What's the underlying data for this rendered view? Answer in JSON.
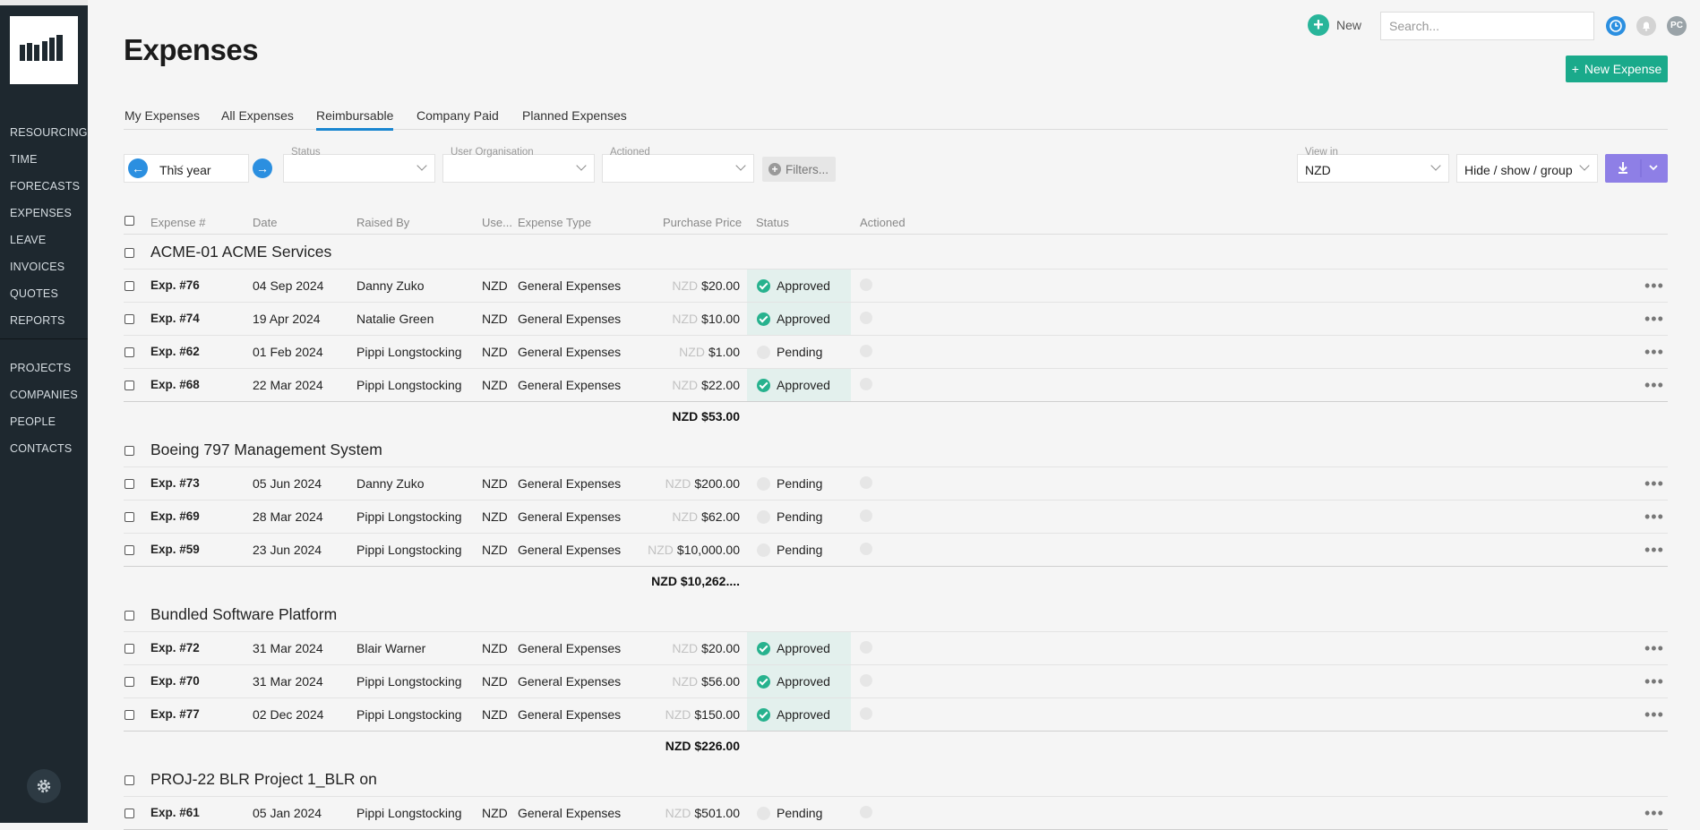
{
  "nav": {
    "items": [
      "RESOURCING",
      "TIME",
      "FORECASTS",
      "EXPENSES",
      "LEAVE",
      "INVOICES",
      "QUOTES",
      "REPORTS"
    ],
    "items2": [
      "PROJECTS",
      "COMPANIES",
      "PEOPLE",
      "CONTACTS"
    ]
  },
  "topbar": {
    "new_label": "New",
    "search_placeholder": "Search...",
    "avatar_initials": "PC"
  },
  "page": {
    "title": "Expenses",
    "new_expense_label": "New Expense"
  },
  "tabs": [
    "My Expenses",
    "All Expenses",
    "Reimbursable",
    "Company Paid",
    "Planned Expenses"
  ],
  "active_tab": "Reimbursable",
  "filters": {
    "period": "This year",
    "status_label": "Status",
    "status_value": "",
    "userorg_label": "User Organisation",
    "userorg_value": "",
    "actioned_label": "Actioned",
    "actioned_value": "",
    "filters_label": "Filters...",
    "viewin_label": "View in",
    "viewin_value": "NZD",
    "hideshow_label": "Hide / show / group"
  },
  "columns": [
    "Expense #",
    "Date",
    "Raised By",
    "Use...",
    "Expense Type",
    "Purchase Price",
    "Status",
    "Actioned"
  ],
  "groups": [
    {
      "title": "ACME-01  ACME Services",
      "rows": [
        {
          "id": "Exp. #76",
          "date": "04 Sep 2024",
          "by": "Danny Zuko",
          "cur": "NZD",
          "type": "General Expenses",
          "pcur": "NZD",
          "price": "$20.00",
          "status": "Approved"
        },
        {
          "id": "Exp. #74",
          "date": "19 Apr 2024",
          "by": "Natalie Green",
          "cur": "NZD",
          "type": "General Expenses",
          "pcur": "NZD",
          "price": "$10.00",
          "status": "Approved"
        },
        {
          "id": "Exp. #62",
          "date": "01 Feb 2024",
          "by": "Pippi Longstocking",
          "cur": "NZD",
          "type": "General Expenses",
          "pcur": "NZD",
          "price": "$1.00",
          "status": "Pending"
        },
        {
          "id": "Exp. #68",
          "date": "22 Mar 2024",
          "by": "Pippi Longstocking",
          "cur": "NZD",
          "type": "General Expenses",
          "pcur": "NZD",
          "price": "$22.00",
          "status": "Approved"
        }
      ],
      "total": "NZD $53.00"
    },
    {
      "title": "Boeing 797 Management System",
      "rows": [
        {
          "id": "Exp. #73",
          "date": "05 Jun 2024",
          "by": "Danny Zuko",
          "cur": "NZD",
          "type": "General Expenses",
          "pcur": "NZD",
          "price": "$200.00",
          "status": "Pending"
        },
        {
          "id": "Exp. #69",
          "date": "28 Mar 2024",
          "by": "Pippi Longstocking",
          "cur": "NZD",
          "type": "General Expenses",
          "pcur": "NZD",
          "price": "$62.00",
          "status": "Pending"
        },
        {
          "id": "Exp. #59",
          "date": "23 Jun 2024",
          "by": "Pippi Longstocking",
          "cur": "NZD",
          "type": "General Expenses",
          "pcur": "NZD",
          "price": "$10,000.00",
          "status": "Pending"
        }
      ],
      "total": "NZD $10,262...."
    },
    {
      "title": "Bundled Software Platform",
      "rows": [
        {
          "id": "Exp. #72",
          "date": "31 Mar 2024",
          "by": "Blair Warner",
          "cur": "NZD",
          "type": "General Expenses",
          "pcur": "NZD",
          "price": "$20.00",
          "status": "Approved"
        },
        {
          "id": "Exp. #70",
          "date": "31 Mar 2024",
          "by": "Pippi Longstocking",
          "cur": "NZD",
          "type": "General Expenses",
          "pcur": "NZD",
          "price": "$56.00",
          "status": "Approved"
        },
        {
          "id": "Exp. #77",
          "date": "02 Dec 2024",
          "by": "Pippi Longstocking",
          "cur": "NZD",
          "type": "General Expenses",
          "pcur": "NZD",
          "price": "$150.00",
          "status": "Approved"
        }
      ],
      "total": "NZD $226.00"
    },
    {
      "title": "PROJ-22  BLR Project 1_BLR on",
      "rows": [
        {
          "id": "Exp. #61",
          "date": "05 Jan 2024",
          "by": "Pippi Longstocking",
          "cur": "NZD",
          "type": "General Expenses",
          "pcur": "NZD",
          "price": "$501.00",
          "status": "Pending"
        }
      ],
      "total": ""
    }
  ],
  "colors": {
    "accent_green": "#1aaa8b",
    "sidebar": "#1e282f",
    "tab_active": "#1a86d0",
    "download": "#8e7fe6"
  }
}
